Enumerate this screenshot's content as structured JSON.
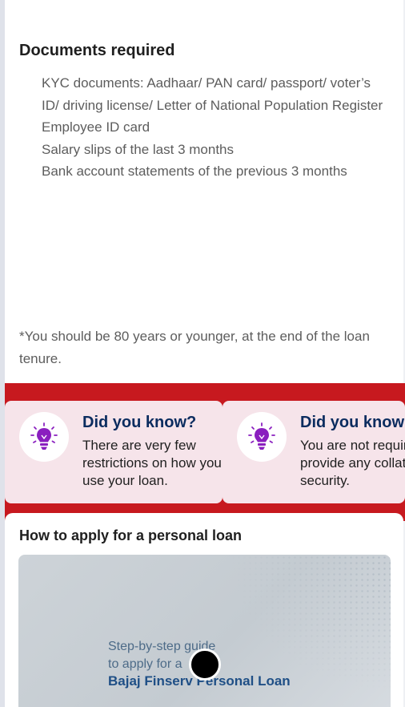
{
  "documents": {
    "title": "Documents required",
    "items": [
      "KYC documents: Aadhaar/ PAN card/ passport/ voter’s ID/ driving license/ Letter of National Population Register",
      "Employee ID card",
      "Salary slips of the last 3 months",
      "Bank account statements of the previous 3 months"
    ],
    "note": "*You should be 80 years or younger, at the end of the loan tenure."
  },
  "did_you_know": {
    "cards": [
      {
        "title": "Did you know?",
        "text": "There are very few restrictions on how you use your loan.",
        "icon": "lightbulb-icon"
      },
      {
        "title": "Did you know?",
        "text": "You are not required to provide any collateral or security.",
        "icon": "lightbulb-icon"
      }
    ]
  },
  "apply": {
    "title": "How to apply for a personal loan",
    "video": {
      "line1": "Step-by-step guide",
      "line2": "to apply for a",
      "line3": "Bajaj Finserv Personal Loan"
    }
  },
  "colors": {
    "accent_red": "#c7191f",
    "card_pink": "#f6e4ea",
    "title_navy": "#0b2c5f",
    "bulb_purple": "#8a1fbf"
  }
}
